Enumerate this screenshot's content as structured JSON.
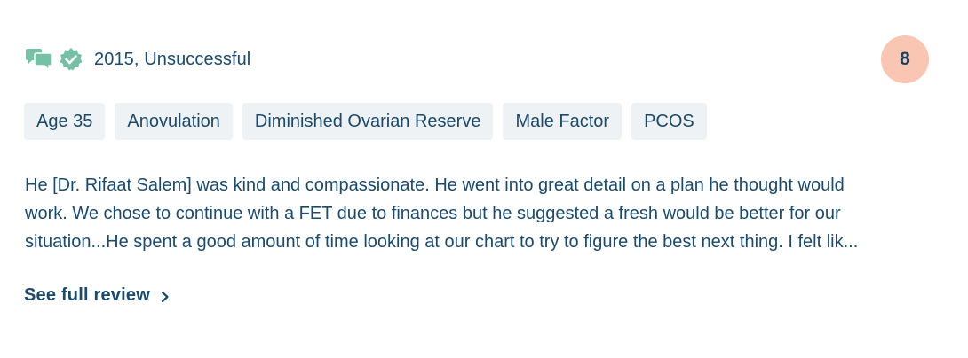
{
  "review": {
    "meta": "2015, Unsuccessful",
    "score": "8",
    "tags": [
      "Age 35",
      "Anovulation",
      "Diminished Ovarian Reserve",
      "Male Factor",
      "PCOS"
    ],
    "text_lines": [
      "He [Dr. Rifaat Salem] was kind and compassionate. He went into great detail on a plan he thought would",
      "work. We chose to continue with a FET due to finances but he suggested a fresh would be better for our",
      "situation...He spent a good amount of time looking at our chart to try to figure the best next thing. I felt lik..."
    ],
    "see_full_label": "See full review",
    "icons": {
      "chat": "chat-bubbles-icon",
      "verified": "verified-badge-icon",
      "chevron": "chevron-right-icon"
    }
  },
  "colors": {
    "text": "#1c4a6b",
    "icon_green": "#76c1a5",
    "tag_bg": "#eef2f4",
    "score_bg": "#f8c6b3"
  }
}
